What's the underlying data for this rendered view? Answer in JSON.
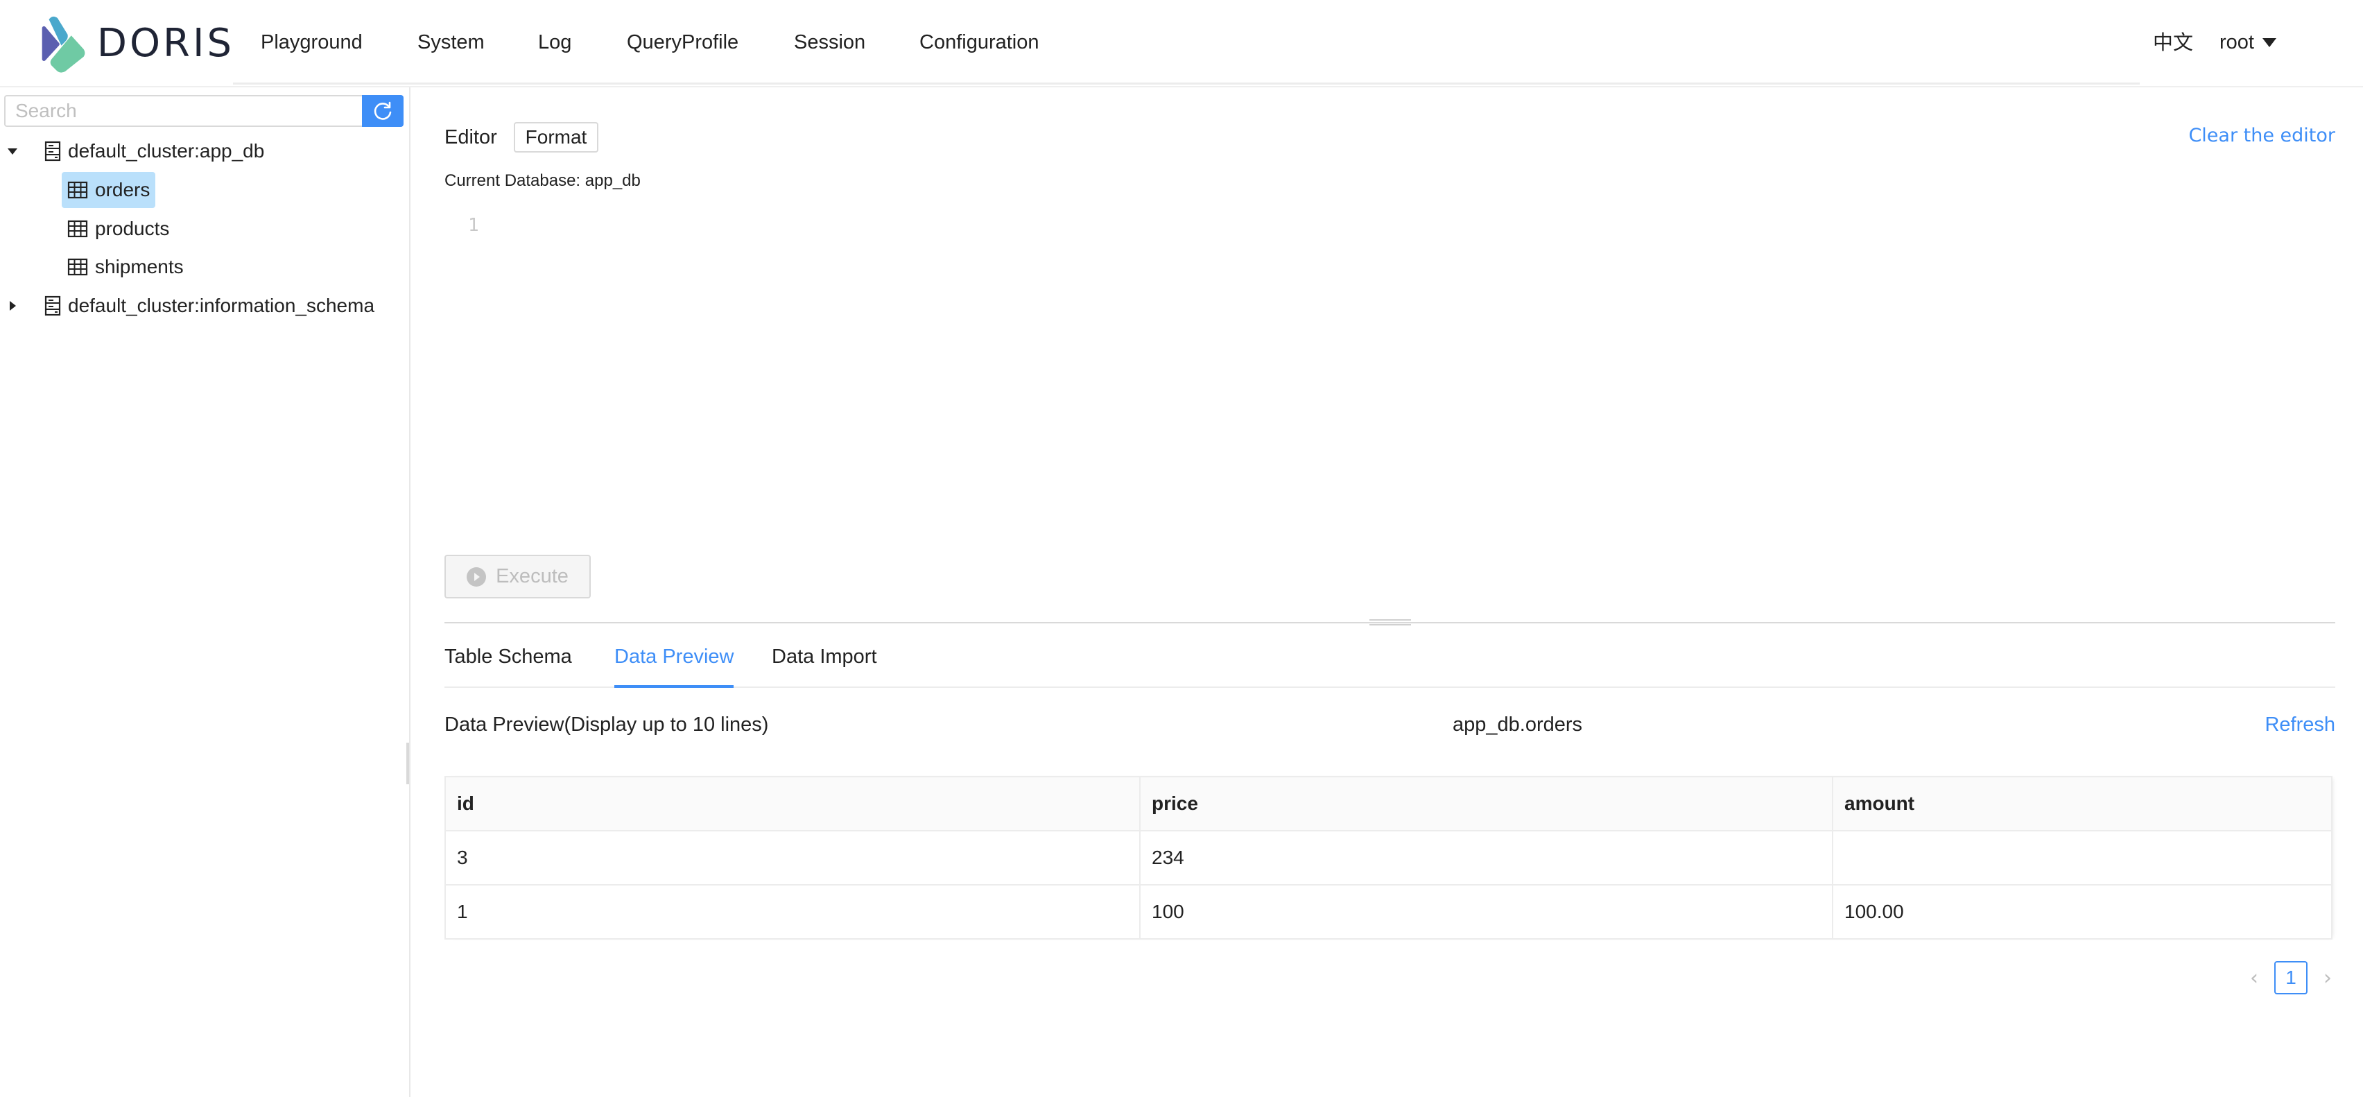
{
  "app": {
    "logo_text": "DORIS",
    "brand_colors": {
      "logo_purple": "#5b5fb0",
      "logo_blue": "#4aa8cc",
      "logo_green": "#6fcaa4",
      "accent": "#3e8ef7"
    }
  },
  "header": {
    "nav": [
      {
        "label": "Playground"
      },
      {
        "label": "System"
      },
      {
        "label": "Log"
      },
      {
        "label": "QueryProfile"
      },
      {
        "label": "Session"
      },
      {
        "label": "Configuration"
      }
    ],
    "language": "中文",
    "user": "root",
    "user_icon": "caret-down-icon"
  },
  "sidebar": {
    "search": {
      "placeholder": "Search",
      "value": "",
      "button_icon": "refresh-icon"
    },
    "tree": [
      {
        "label": "default_cluster:app_db",
        "type": "database",
        "expanded": true,
        "children": [
          {
            "label": "orders",
            "type": "table",
            "selected": true
          },
          {
            "label": "products",
            "type": "table",
            "selected": false
          },
          {
            "label": "shipments",
            "type": "table",
            "selected": false
          }
        ]
      },
      {
        "label": "default_cluster:information_schema",
        "type": "database",
        "expanded": false,
        "children": []
      }
    ]
  },
  "editor": {
    "label": "Editor",
    "format_button": "Format",
    "clear_link": "Clear the editor",
    "current_database": "Current Database: app_db",
    "line_numbers": [
      "1"
    ],
    "content": "",
    "execute_button": "Execute",
    "execute_icon": "play-circle-icon"
  },
  "tabs": [
    {
      "label": "Table Schema",
      "active": false
    },
    {
      "label": "Data Preview",
      "active": true
    },
    {
      "label": "Data Import",
      "active": false
    }
  ],
  "data_preview": {
    "title": "Data Preview(Display up to 10 lines)",
    "table_name": "app_db.orders",
    "refresh_label": "Refresh",
    "columns": [
      "id",
      "price",
      "amount"
    ],
    "rows": [
      [
        "3",
        "234",
        ""
      ],
      [
        "1",
        "100",
        "100.00"
      ]
    ],
    "pagination": {
      "current_page": "1",
      "prev_icon": "chevron-left-icon",
      "next_icon": "chevron-right-icon"
    }
  }
}
